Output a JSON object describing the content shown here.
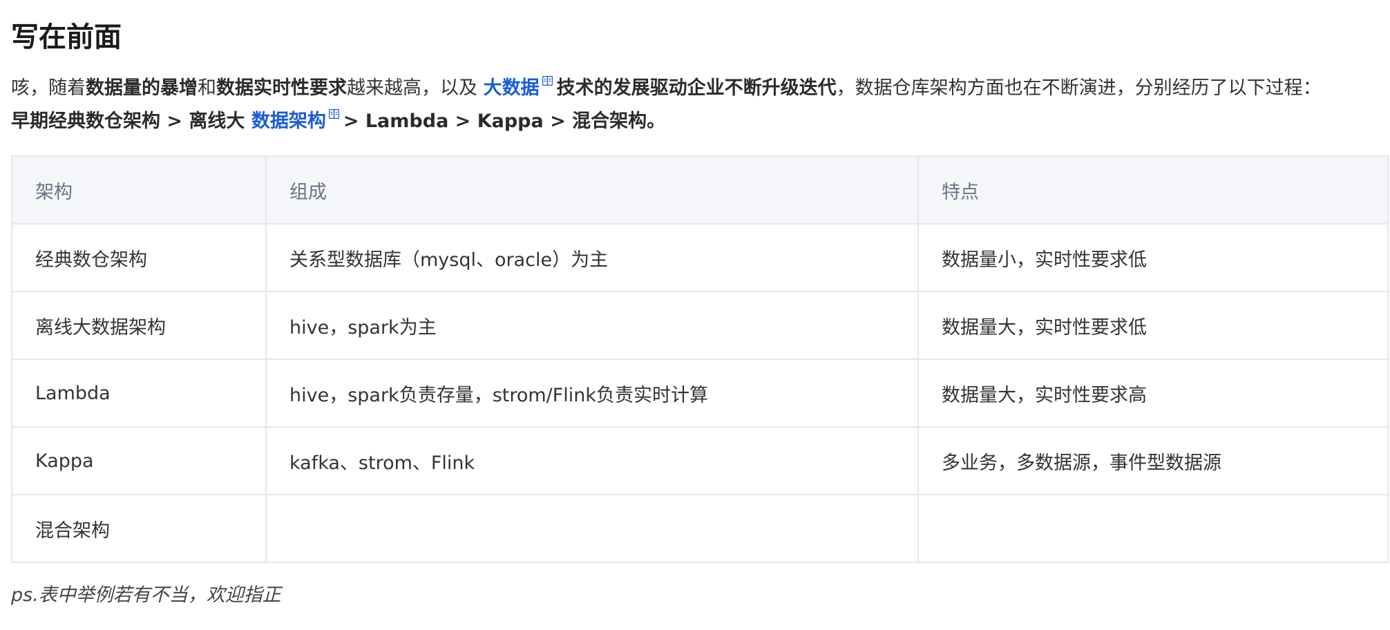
{
  "heading": "写在前面",
  "intro": {
    "l1_a": "咳，随着",
    "l1_b": "数据量的暴增",
    "l1_c": "和",
    "l1_d": "数据实时性要求",
    "l1_e": "越来越高，以及 ",
    "l1_link": "大数据",
    "l1_f": "技术的发展驱动企业不断升级迭代",
    "l1_g": "，数据仓库架构方面也在不断演进，分别经历了以下过程：",
    "l2_a": "早期经典数仓架构 > 离线大 ",
    "l2_link": "数据架构",
    "l2_b": "> Lambda > Kappa > 混合架构。"
  },
  "table": {
    "headers": [
      "架构",
      "组成",
      "特点"
    ],
    "rows": [
      [
        "经典数仓架构",
        "关系型数据库（mysql、oracle）为主",
        "数据量小，实时性要求低"
      ],
      [
        "离线大数据架构",
        "hive，spark为主",
        "数据量大，实时性要求低"
      ],
      [
        "Lambda",
        "hive，spark负责存量，strom/Flink负责实时计算",
        "数据量大，实时性要求高"
      ],
      [
        "Kappa",
        "kafka、strom、Flink",
        "多业务，多数据源，事件型数据源"
      ],
      [
        "混合架构",
        "",
        ""
      ]
    ]
  },
  "note": "ps.表中举例若有不当，欢迎指正",
  "colors": {
    "link": "#1a5cd8",
    "header_bg": "#f5f6f9",
    "border": "#e4e6eb"
  },
  "icons": [
    "book-icon"
  ]
}
